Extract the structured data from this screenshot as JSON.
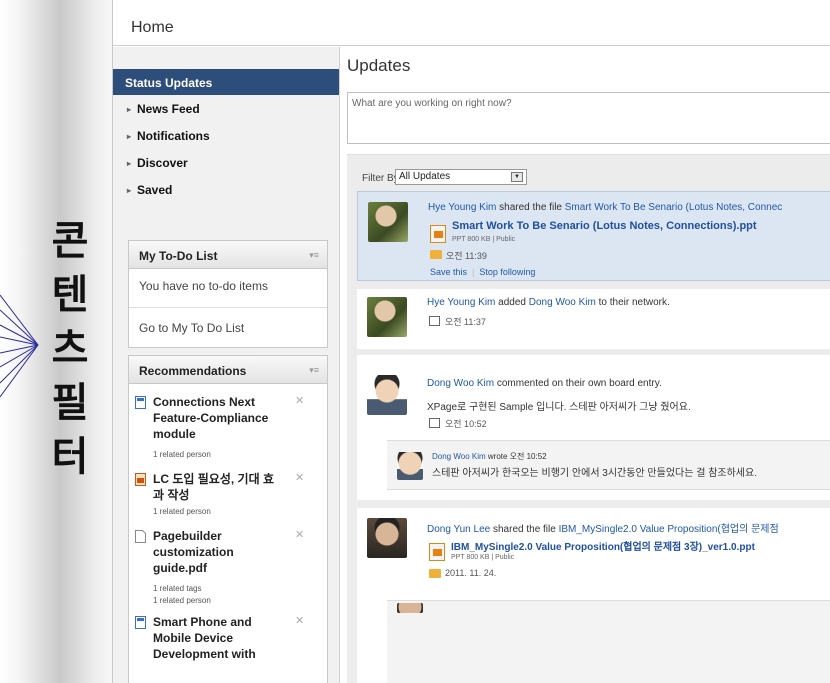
{
  "side_text": [
    "콘",
    "텐",
    "츠",
    "필",
    "터"
  ],
  "header": {
    "title": "Home"
  },
  "sidebar": {
    "active": "Status Updates",
    "items": [
      {
        "label": "News Feed"
      },
      {
        "label": "Notifications"
      },
      {
        "label": "Discover"
      },
      {
        "label": "Saved"
      }
    ]
  },
  "todo": {
    "title": "My To-Do List",
    "empty_text": "You have no to-do items",
    "link": "Go to My To Do List"
  },
  "recommendations": {
    "title": "Recommendations",
    "items": [
      {
        "title": "Connections Next Feature-Compliance module",
        "meta": [
          "1 related person"
        ]
      },
      {
        "title": "LC 도입 필요성, 기대 효과 작성",
        "meta": [
          "1 related person"
        ]
      },
      {
        "title": "Pagebuilder customization guide.pdf",
        "meta": [
          "1 related tags",
          "1 related person"
        ]
      },
      {
        "title": "Smart Phone and Mobile Device Development with",
        "meta": []
      }
    ]
  },
  "main": {
    "title": "Updates",
    "status_placeholder": "What are you working on right now?",
    "filter_label": "Filter By:",
    "filter_value": "All Updates"
  },
  "feed": [
    {
      "actor": "Hye Young Kim",
      "action": " shared the file ",
      "target": "Smart Work To Be Senario (Lotus Notes, Connec",
      "file_title": "Smart Work To Be Senario (Lotus Notes, Connections).ppt",
      "file_meta": "PPT 800 KB  |  Public",
      "time": "오전 11:39",
      "actions": [
        "Save this",
        "Stop following"
      ]
    },
    {
      "actor": "Hye Young Kim",
      "action": " added ",
      "target": "Dong Woo Kim",
      "suffix": " to their network.",
      "time": "오전 11:37"
    },
    {
      "actor": "Dong Woo Kim",
      "action": " commented on their own board entry.",
      "body": "XPage로 구현된 Sample 입니다. 스테판 아저씨가 그냥 줬어요.",
      "time": "오전 10:52"
    },
    {
      "reply_author": "Dong Woo Kim",
      "reply_meta": " wrote 오전 10:52",
      "reply_body": "스테판 아저씨가 한국오는 비행기 안에서 3시간동안 만들었다는 걸 참조하세요."
    },
    {
      "actor": "Dong Yun Lee",
      "action": " shared the file ",
      "target": "IBM_MySingle2.0 Value Proposition(협업의 문제점",
      "file_title": "IBM_MySingle2.0 Value Proposition(협업의 문제점 3장)_ver1.0.ppt",
      "file_meta": "PPT 800 KB  |  Public",
      "time": "2011. 11. 24."
    }
  ]
}
